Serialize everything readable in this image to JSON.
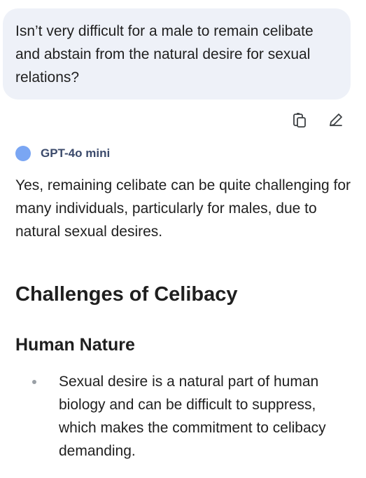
{
  "user_message": {
    "text": "Isn’t very difficult for a male to remain celibate and abstain from the natural desire for sexual relations?"
  },
  "message_actions": {
    "copy_icon": "copy-icon",
    "edit_icon": "edit-pencil-icon"
  },
  "assistant": {
    "model_name": "GPT-4o mini",
    "avatar_color": "#7aa6f3",
    "intro": "Yes, remaining celibate can be quite challenging for many individuals, particularly for males, due to natural sexual desires.",
    "heading": "Challenges of Celibacy",
    "subheading": "Human Nature",
    "bullets": [
      "Sexual desire is a natural part of human biology and can be difficult to suppress, which makes the commitment to celibacy demanding."
    ]
  },
  "colors": {
    "user_bubble_bg": "#eef1f8",
    "text": "#1f1f1f"
  }
}
